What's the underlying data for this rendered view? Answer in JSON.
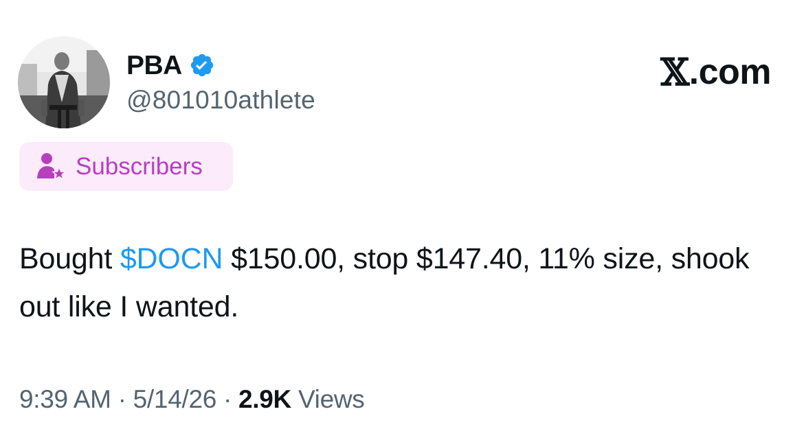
{
  "author": {
    "display_name": "PBA",
    "handle": "@801010athlete",
    "verified": true,
    "verified_color": "#1d9bf0"
  },
  "brand": {
    "prefix_glyph": "𝕏",
    "suffix": ".com"
  },
  "badge": {
    "label": "Subscribers",
    "icon": "subscriber-star-icon",
    "text_color": "#b73fbe",
    "background": "#fbebfb"
  },
  "tweet": {
    "before_cashtag": "Bought ",
    "cashtag": "$DOCN",
    "after_cashtag": " $150.00, stop $147.40, 11% size, shook out like I wanted."
  },
  "meta": {
    "time": "9:39 AM",
    "separator": "·",
    "date": "5/14/26",
    "views_count": "2.9K",
    "views_label": "Views"
  },
  "colors": {
    "text_primary": "#0f1419",
    "text_secondary": "#536471",
    "link": "#1d9bf0"
  }
}
